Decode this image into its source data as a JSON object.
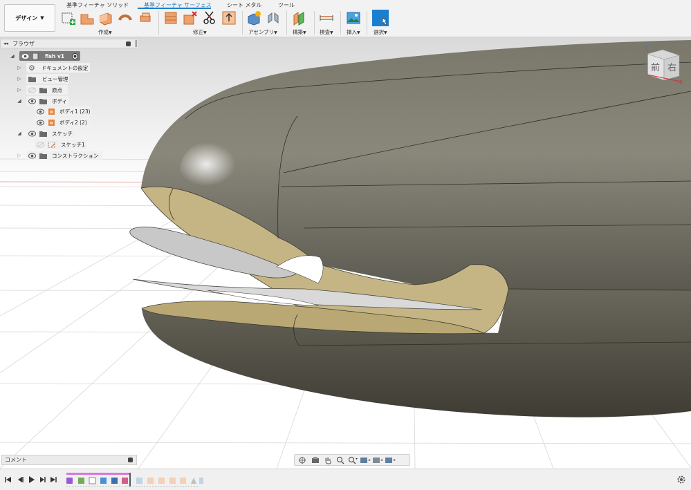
{
  "app": {
    "workspace_button": "デザイン",
    "tabs": [
      {
        "label": "基準フィーチャ ソリッド",
        "active": false
      },
      {
        "label": "基準フィーチャ サーフェス",
        "active": true
      },
      {
        "label": "シート メタル",
        "active": false
      },
      {
        "label": "ツール",
        "active": false
      }
    ],
    "groups": [
      {
        "label": "作成"
      },
      {
        "label": "修正"
      },
      {
        "label": "アセンブリ"
      },
      {
        "label": "構築"
      },
      {
        "label": "検査"
      },
      {
        "label": "挿入"
      },
      {
        "label": "選択"
      }
    ]
  },
  "browser": {
    "title": "ブラウザ",
    "items": [
      {
        "label": "fish v1",
        "icon": "document-icon"
      },
      {
        "label": "ドキュメントの設定",
        "icon": "gear-icon"
      },
      {
        "label": "ビュー管理",
        "icon": "folder-icon"
      },
      {
        "label": "原点",
        "icon": "folder-icon"
      },
      {
        "label": "ボディ",
        "icon": "folder-icon"
      },
      {
        "label": "ボディ1 (23)",
        "icon": "body-icon"
      },
      {
        "label": "ボディ2 (2)",
        "icon": "body-icon"
      },
      {
        "label": "スケッチ",
        "icon": "folder-icon"
      },
      {
        "label": "スケッチ1",
        "icon": "sketch-icon"
      },
      {
        "label": "コンストラクション",
        "icon": "folder-icon"
      }
    ]
  },
  "viewcube": {
    "front": "前",
    "right": "右",
    "axis_z": "Z",
    "axis_x": "X"
  },
  "comments": {
    "title": "コメント"
  },
  "colors": {
    "accent": "#1b7fcf",
    "body_shell": "#6e6b5f",
    "section_face": "#c6b584",
    "surface_sheet": "#c8c8c8",
    "grid": "#d9d9d9"
  }
}
